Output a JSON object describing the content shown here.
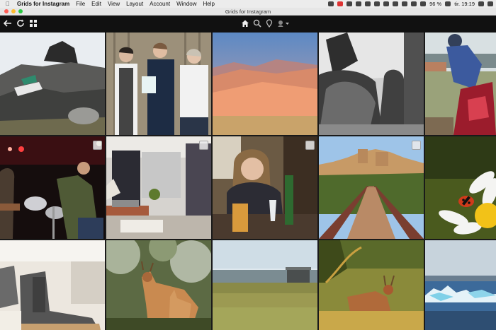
{
  "menubar": {
    "app_name": "Grids for Instagram",
    "items": [
      "File",
      "Edit",
      "View",
      "Layout",
      "Account",
      "Window",
      "Help"
    ],
    "battery": "96 %",
    "clock": "tir. 19:19"
  },
  "window": {
    "title": "Grids for Instagram"
  },
  "toolbar": {
    "left_icons": [
      "back-arrow-icon",
      "refresh-icon",
      "grid-layout-icon"
    ],
    "center_icons": [
      "home-icon",
      "search-icon",
      "location-pin-icon",
      "account-dropdown-icon"
    ]
  },
  "grid": {
    "tiles": [
      {
        "id": "t1",
        "subject": "rocks"
      },
      {
        "id": "t2",
        "subject": "people"
      },
      {
        "id": "t3",
        "subject": "desert"
      },
      {
        "id": "t4",
        "subject": "bw-woman"
      },
      {
        "id": "t5",
        "subject": "fisherman"
      },
      {
        "id": "t6",
        "subject": "concert",
        "multi": true
      },
      {
        "id": "t7",
        "subject": "interior",
        "multi": true
      },
      {
        "id": "t8",
        "subject": "woman-wine",
        "multi": true
      },
      {
        "id": "t9",
        "subject": "bridge",
        "multi": true
      },
      {
        "id": "t10",
        "subject": "ladybug"
      },
      {
        "id": "t11",
        "subject": "boots"
      },
      {
        "id": "t12",
        "subject": "deer1"
      },
      {
        "id": "t13",
        "subject": "beach-hut"
      },
      {
        "id": "t14",
        "subject": "deer2"
      },
      {
        "id": "t15",
        "subject": "icebergs"
      }
    ]
  }
}
